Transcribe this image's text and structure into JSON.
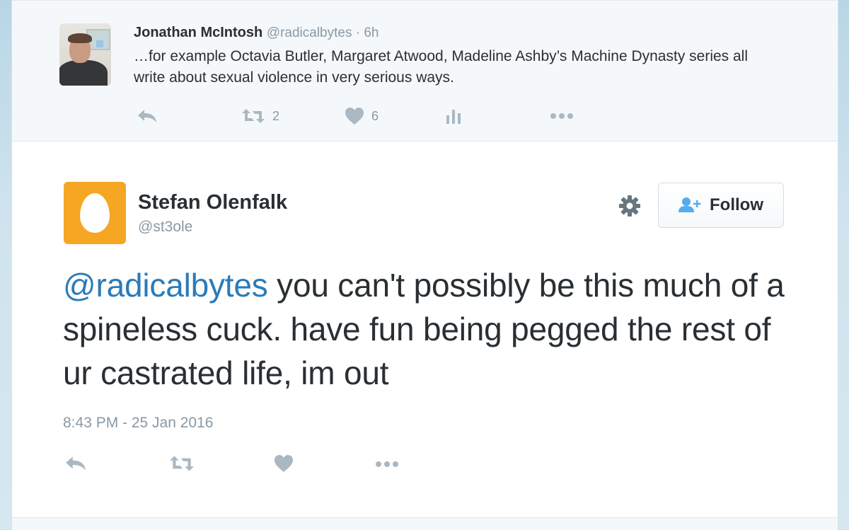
{
  "parent_tweet": {
    "name": "Jonathan McIntosh",
    "handle": "@radicalbytes",
    "separator": " · ",
    "time": "6h",
    "text": "…for example Octavia Butler, Margaret Atwood, Madeline Ashby’s Machine Dynasty series all write about sexual violence in very serious ways.",
    "retweet_count": "2",
    "like_count": "6",
    "actions": [
      "reply-icon",
      "retweet-icon",
      "heart-icon",
      "analytics-icon",
      "more-icon"
    ]
  },
  "main_tweet": {
    "name": "Stefan Olenfalk",
    "handle": "@st3ole",
    "follow_label": "Follow",
    "mention": "@radicalbytes",
    "text": " you can't possibly be this much of a spineless cuck. have fun being pegged the rest of ur castrated life, im out",
    "timestamp": "8:43 PM - 25 Jan 2016",
    "actions": [
      "reply-icon",
      "retweet-icon",
      "heart-icon",
      "more-icon"
    ]
  },
  "colors": {
    "text": "#292f33",
    "muted": "#8899a6",
    "icon": "#aab8c2",
    "link": "#2b7bb9",
    "egg_bg": "#f5a623",
    "parent_bg": "#f5f8fa"
  }
}
